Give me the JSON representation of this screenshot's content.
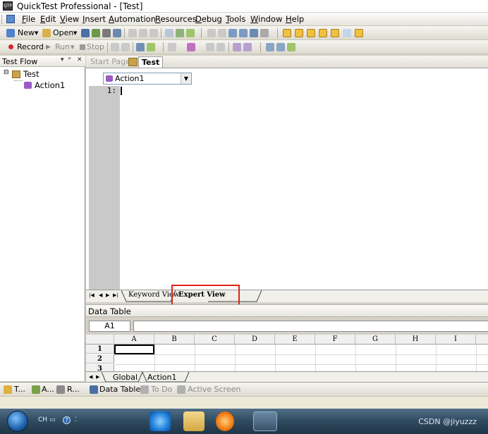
{
  "window": {
    "title": "QuickTest Professional - [Test]",
    "app_icon": "qtp-app-icon"
  },
  "menubar": [
    "File",
    "Edit",
    "View",
    "Insert",
    "Automation",
    "Resources",
    "Debug",
    "Tools",
    "Window",
    "Help"
  ],
  "toolbar1": {
    "new_label": "New",
    "open_label": "Open"
  },
  "toolbar2": {
    "record_label": "Record",
    "run_label": "Run",
    "stop_label": "Stop"
  },
  "test_flow": {
    "title": "Test Flow",
    "pin": "▾ ᵖ ✕",
    "root": "Test",
    "child": "Action1"
  },
  "doc_tabs": {
    "start_page": "Start Page",
    "active": "Test"
  },
  "editor": {
    "action_combo": "Action1",
    "line_number": "1:"
  },
  "view_tabs": {
    "keyword": "Keyword View",
    "expert": "Expert View"
  },
  "data_table": {
    "title": "Data Table",
    "cell_ref": "A1",
    "columns": [
      "A",
      "B",
      "C",
      "D",
      "E",
      "F",
      "G",
      "H",
      "I"
    ],
    "rows": [
      "1",
      "2",
      "3"
    ],
    "sheets": [
      "Global",
      "Action1"
    ]
  },
  "bottom_tabs": {
    "left": [
      "T...",
      "A...",
      "R..."
    ],
    "data_table": "Data Table",
    "todo": "To Do",
    "active_screen": "Active Screen"
  },
  "taskbar": {
    "lang": "CH",
    "watermark": "CSDN @jiyuzzz"
  }
}
